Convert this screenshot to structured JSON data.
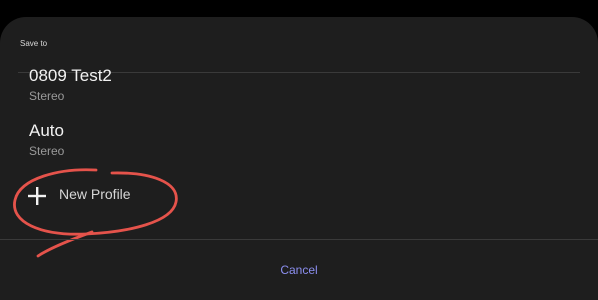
{
  "dialog": {
    "title": "Save to"
  },
  "profiles": [
    {
      "name": "0809 Test2",
      "subtitle": "Stereo"
    },
    {
      "name": "Auto",
      "subtitle": "Stereo"
    }
  ],
  "new_profile": {
    "label": "New Profile",
    "icon": "plus-icon"
  },
  "cancel": {
    "label": "Cancel"
  },
  "colors": {
    "sheet_background": "#1e1e1e",
    "accent": "#8c8ff0",
    "annotation": "#e5534b"
  }
}
